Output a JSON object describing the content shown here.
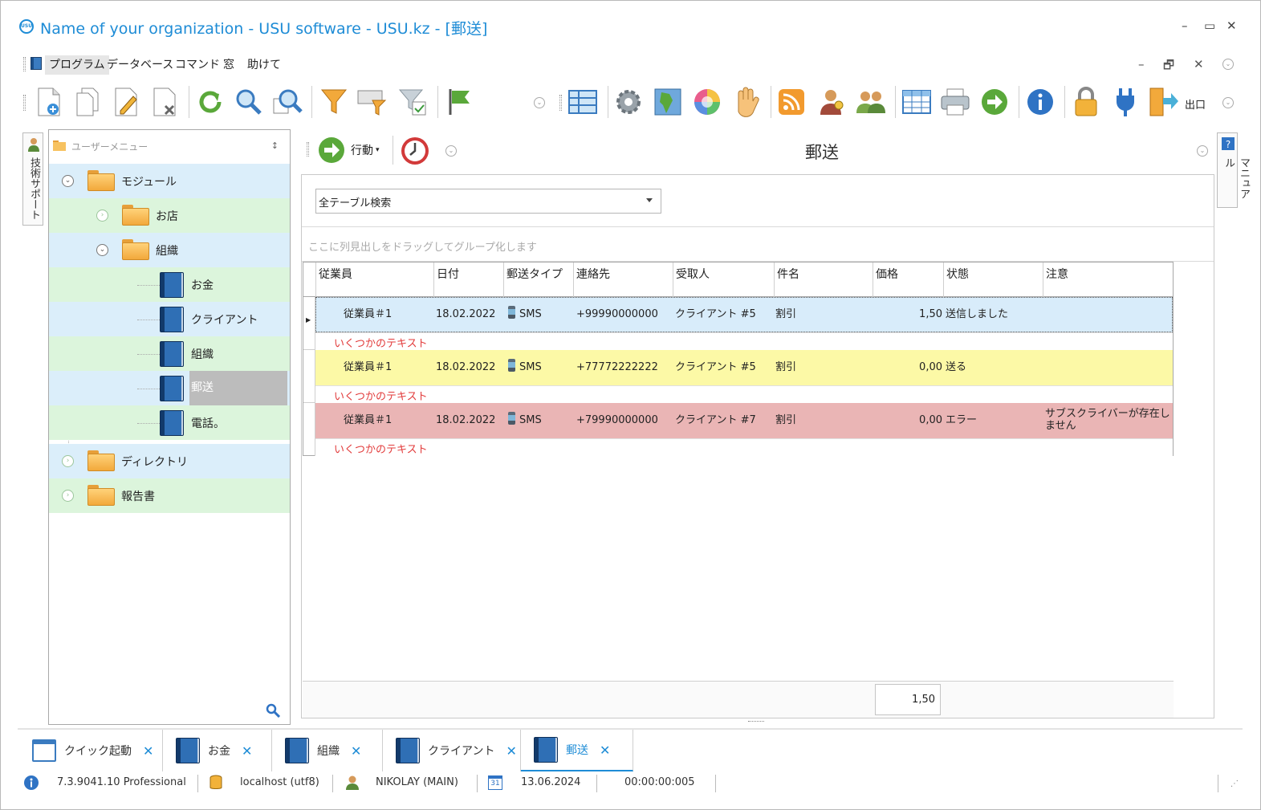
{
  "window": {
    "title": "Name of your organization - USU software - USU.kz - [郵送]",
    "logo_text": "USU",
    "minimize": "–",
    "maximize": "▭",
    "close": "✕"
  },
  "menu": {
    "items": [
      "プログラム",
      "データベース",
      "コマンド",
      "窓",
      "助けて"
    ],
    "active_index": 0,
    "mdi_minimize": "–",
    "mdi_restore": "🗗",
    "mdi_close": "✕"
  },
  "toolbar": {
    "exit_label": "出口",
    "icons": [
      "new-doc-icon",
      "copy-doc-icon",
      "edit-doc-icon",
      "delete-doc-icon",
      "refresh-icon",
      "search-icon",
      "search-advanced-icon",
      "filter-icon",
      "filter-select-icon",
      "filter-clear-icon",
      "flag-icon",
      "layout-icon",
      "settings-icon",
      "map-icon",
      "color-wheel-icon",
      "hand-icon",
      "rss-icon",
      "user-key-icon",
      "users-icon",
      "table-icon",
      "printer-icon",
      "arrow-right-icon",
      "info-icon",
      "lock-icon",
      "plug-icon",
      "exit-icon"
    ]
  },
  "side_tabs": {
    "left": "技術サポート",
    "right": "マニュアル"
  },
  "left_panel": {
    "title": "ユーザーメニュー",
    "pin": "📌",
    "tree": [
      {
        "label": "モジュール",
        "level": 0,
        "type": "folder-open",
        "expander": "collapse",
        "bg": "blue"
      },
      {
        "label": "お店",
        "level": 1,
        "type": "folder",
        "expander": "expand",
        "bg": "green"
      },
      {
        "label": "組織",
        "level": 1,
        "type": "folder-open",
        "expander": "collapse",
        "bg": "blue"
      },
      {
        "label": "お金",
        "level": 2,
        "type": "book",
        "bg": "green"
      },
      {
        "label": "クライアント",
        "level": 2,
        "type": "book",
        "bg": "blue"
      },
      {
        "label": "組織",
        "level": 2,
        "type": "book",
        "bg": "green"
      },
      {
        "label": "郵送",
        "level": 2,
        "type": "book",
        "bg": "blue",
        "selected": true
      },
      {
        "label": "電話。",
        "level": 2,
        "type": "book",
        "bg": "green"
      },
      {
        "label": "ディレクトリ",
        "level": 0,
        "type": "folder",
        "expander": "expand",
        "bg": "blue"
      },
      {
        "label": "報告書",
        "level": 0,
        "type": "folder",
        "expander": "expand",
        "bg": "green"
      }
    ]
  },
  "main": {
    "action_label": "行動",
    "page_title": "郵送",
    "search_combo_value": "全テーブル検索",
    "group_hint": "ここに列見出しをドラッグしてグループ化します",
    "columns": [
      "従業員",
      "日付",
      "郵送タイプ",
      "連絡先",
      "受取人",
      "件名",
      "価格",
      "状態",
      "注意"
    ],
    "rows": [
      {
        "employee": "従業員＃1",
        "date": "18.02.2022",
        "type": "SMS",
        "contact": "+99990000000",
        "recipient": "クライアント #5",
        "subject": "割引",
        "price": "1,50",
        "status": "送信しました",
        "note": "",
        "preview": "いくつかのテキスト",
        "color": "blue"
      },
      {
        "employee": "従業員＃1",
        "date": "18.02.2022",
        "type": "SMS",
        "contact": "+77772222222",
        "recipient": "クライアント #5",
        "subject": "割引",
        "price": "0,00",
        "status": "送る",
        "note": "",
        "preview": "いくつかのテキスト",
        "color": "yellow"
      },
      {
        "employee": "従業員＃1",
        "date": "18.02.2022",
        "type": "SMS",
        "contact": "+79990000000",
        "recipient": "クライアント #7",
        "subject": "割引",
        "price": "0,00",
        "status": "エラー",
        "note": "サブスクライバーが存在しません",
        "preview": "いくつかのテキスト",
        "color": "red"
      }
    ],
    "price_total": "1,50",
    "row_colors": {
      "blue": "#d8ecfa",
      "yellow": "#fcf9a6",
      "red": "#eab5b5",
      "preview_text": "#e23b3b"
    }
  },
  "tabs": [
    {
      "label": "クイック起動",
      "icon": "window-icon"
    },
    {
      "label": "お金",
      "icon": "book-icon"
    },
    {
      "label": "組織",
      "icon": "book-icon"
    },
    {
      "label": "クライアント",
      "icon": "book-icon"
    },
    {
      "label": "郵送",
      "icon": "book-icon",
      "active": true
    }
  ],
  "status_bar": {
    "version": "7.3.9041.10 Professional",
    "server": "localhost (utf8)",
    "user": "NIKOLAY (MAIN)",
    "date": "13.06.2024",
    "calendar_day": "31",
    "timer": "00:00:00:005"
  },
  "colors": {
    "accent": "#1e8cd6",
    "tree_blue": "#dbeefa",
    "tree_green": "#dcf5dc",
    "tree_selected": "#bcbcbc"
  }
}
